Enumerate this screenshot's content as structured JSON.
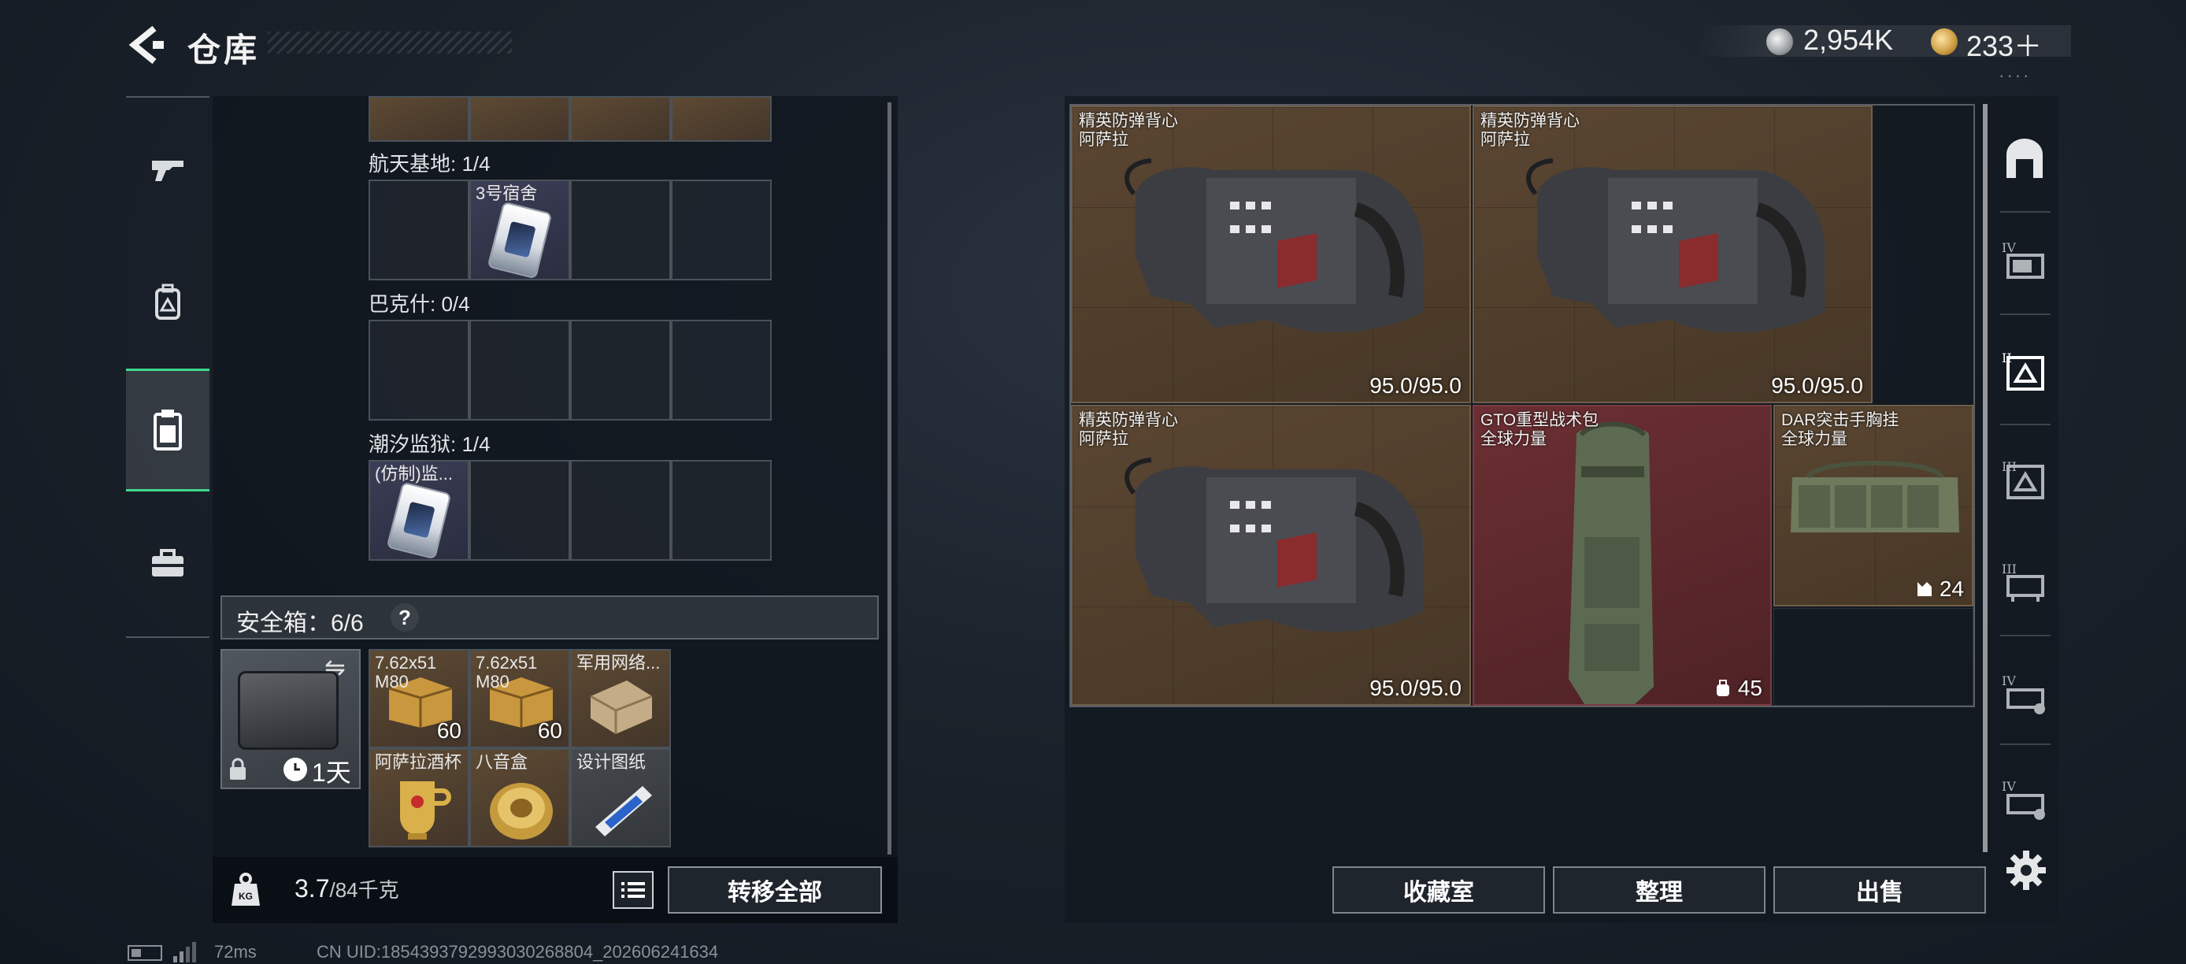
{
  "header": {
    "title": "仓库",
    "back_icon": "back-arrow-icon"
  },
  "currency": {
    "coins": "2,954K",
    "coins_icon": "silver-coin-icon",
    "tokens": "233＋",
    "tokens_icon": "gold-token-icon"
  },
  "left_rail": {
    "items": [
      {
        "name": "weapons-tab",
        "icon": "rifle-icon"
      },
      {
        "name": "equipment-tab",
        "icon": "backpack-icon"
      },
      {
        "name": "keycards-tab",
        "icon": "keycard-icon",
        "active": true
      },
      {
        "name": "misc-tab",
        "icon": "toolbox-icon"
      }
    ],
    "active_color": "#3fd88c"
  },
  "key_sections": [
    {
      "label": "航天基地: 1/4",
      "slots": [
        "3号宿舍",
        "",
        "",
        ""
      ]
    },
    {
      "label": "巴克什: 0/4",
      "slots": [
        "",
        "",
        "",
        ""
      ]
    },
    {
      "label": "潮汐监狱: 1/4",
      "slots": [
        "(仿制)监...",
        "",
        "",
        ""
      ]
    }
  ],
  "safebox": {
    "label": "安全箱：6/6",
    "help": "?",
    "swap": "⇋",
    "time_left": "1天",
    "items": [
      {
        "name": "7.62x51\nM80",
        "count": "60"
      },
      {
        "name": "7.62x51\nM80",
        "count": "60"
      },
      {
        "name": "军用网络...",
        "count": ""
      },
      {
        "name": "阿萨拉酒杯",
        "count": ""
      },
      {
        "name": "八音盒",
        "count": ""
      },
      {
        "name": "设计图纸",
        "count": ""
      }
    ]
  },
  "weight": {
    "current": "3.7",
    "max": "/84千克"
  },
  "buttons": {
    "transfer_all": "转移全部",
    "collection": "收藏室",
    "organize": "整理",
    "sell": "出售"
  },
  "stash_items": [
    {
      "name_line1": "精英防弹背心",
      "name_line2": "阿萨拉",
      "durability": "95.0/95.0"
    },
    {
      "name_line1": "精英防弹背心",
      "name_line2": "阿萨拉",
      "durability": "95.0/95.0"
    },
    {
      "name_line1": "精英防弹背心",
      "name_line2": "阿萨拉",
      "durability": "95.0/95.0"
    },
    {
      "name_line1": "GTO重型战术包",
      "name_line2": "全球力量",
      "capacity": "45"
    },
    {
      "name_line1": "DAR突击手胸挂",
      "name_line2": "全球力量",
      "capacity": "24"
    }
  ],
  "right_tabs": [
    {
      "name": "all-stash-tab",
      "tier": ""
    },
    {
      "name": "stash-tab-4a",
      "tier": "IV"
    },
    {
      "name": "stash-tab-2",
      "tier": "II",
      "active": true
    },
    {
      "name": "stash-tab-3a",
      "tier": "III"
    },
    {
      "name": "stash-tab-3b",
      "tier": "III"
    },
    {
      "name": "stash-tab-4b",
      "tier": "IV"
    },
    {
      "name": "stash-tab-4c",
      "tier": "IV"
    }
  ],
  "footer": {
    "ping": "72ms",
    "uid": "CN UID:1854393792993030268804_202606241634"
  }
}
